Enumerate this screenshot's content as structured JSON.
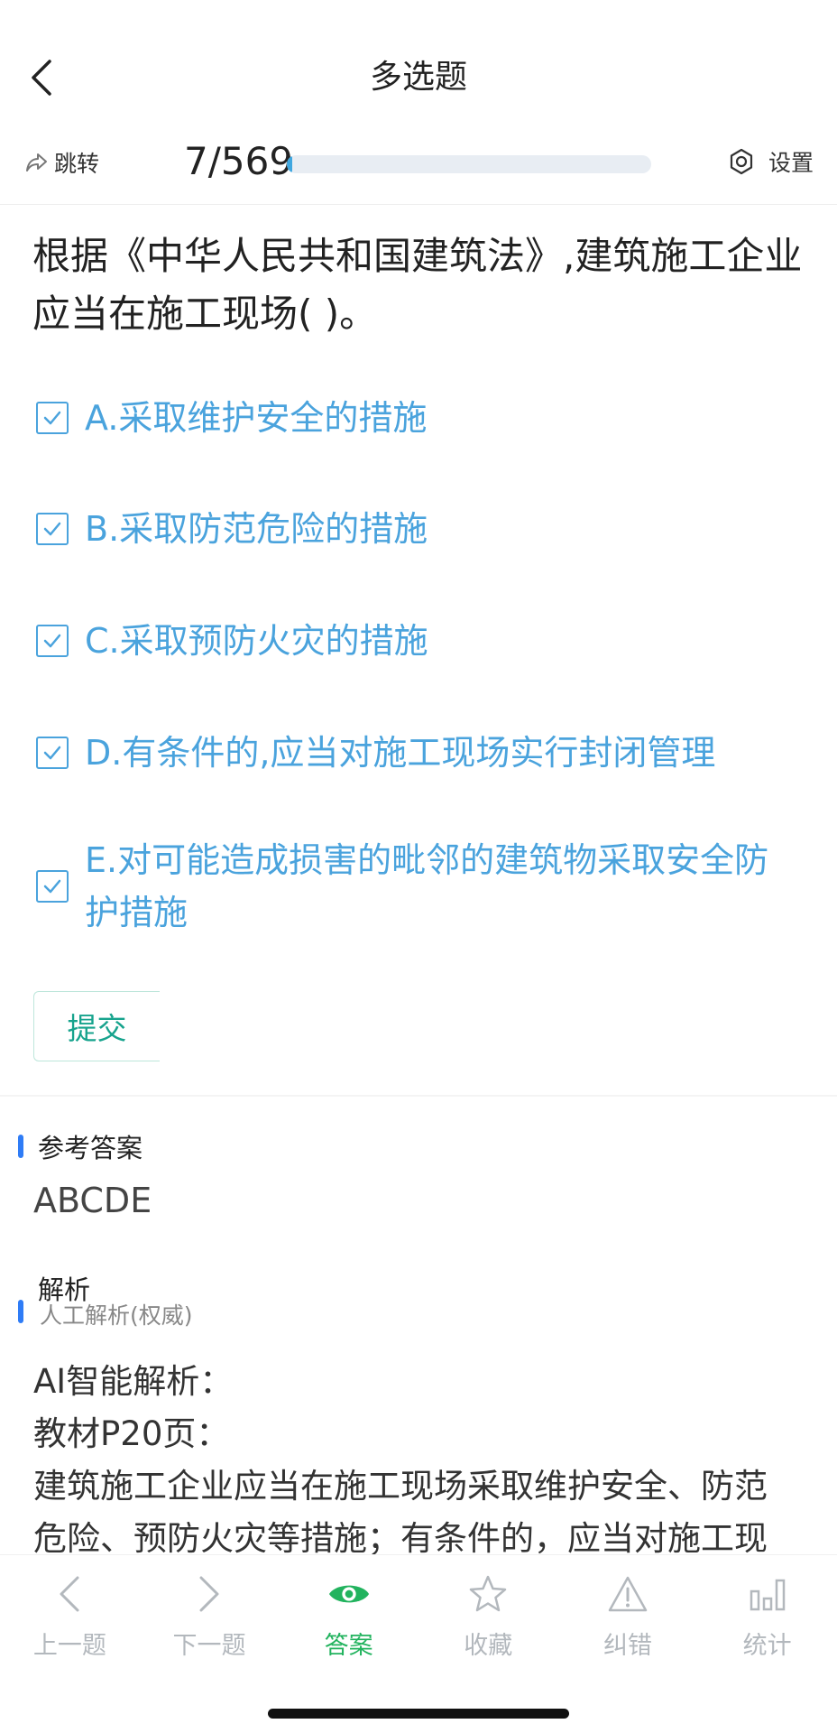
{
  "header": {
    "title": "多选题"
  },
  "toolbar": {
    "jump_label": "跳转",
    "progress_text": "7/569",
    "progress_fraction": 0.0123,
    "settings_label": "设置"
  },
  "question": {
    "text": "根据《中华人民共和国建筑法》,建筑施工企业应当在施工现场( )。"
  },
  "options": [
    {
      "label": "A.采取维护安全的措施",
      "checked": true
    },
    {
      "label": "B.采取防范危险的措施",
      "checked": true
    },
    {
      "label": "C.采取预防火灾的措施",
      "checked": true
    },
    {
      "label": "D.有条件的,应当对施工现场实行封闭管理",
      "checked": true
    },
    {
      "label": "E.对可能造成损害的毗邻的建筑物采取安全防护措施",
      "checked": true
    }
  ],
  "submit_label": "提交",
  "answer": {
    "section_title": "参考答案",
    "value": "ABCDE"
  },
  "analysis": {
    "section_title": "解析",
    "subtitle": "人工解析(权威)",
    "lines": [
      "AI智能解析：",
      "教材P20页：",
      "建筑施工企业应当在施工现场采取维护安全、防范",
      "危险、预防火灾等措施；有条件的，应当对施工现"
    ]
  },
  "bottom_nav": [
    {
      "label": "上一题",
      "icon": "chevron-left-icon"
    },
    {
      "label": "下一题",
      "icon": "chevron-right-icon"
    },
    {
      "label": "答案",
      "icon": "eye-icon",
      "active": true
    },
    {
      "label": "收藏",
      "icon": "star-icon"
    },
    {
      "label": "纠错",
      "icon": "warning-icon"
    },
    {
      "label": "统计",
      "icon": "bar-chart-icon"
    }
  ],
  "colors": {
    "option_blue": "#4aa3dd",
    "active_green": "#22b35e",
    "section_bar": "#2f7cf6",
    "submit_green": "#17a38d"
  }
}
